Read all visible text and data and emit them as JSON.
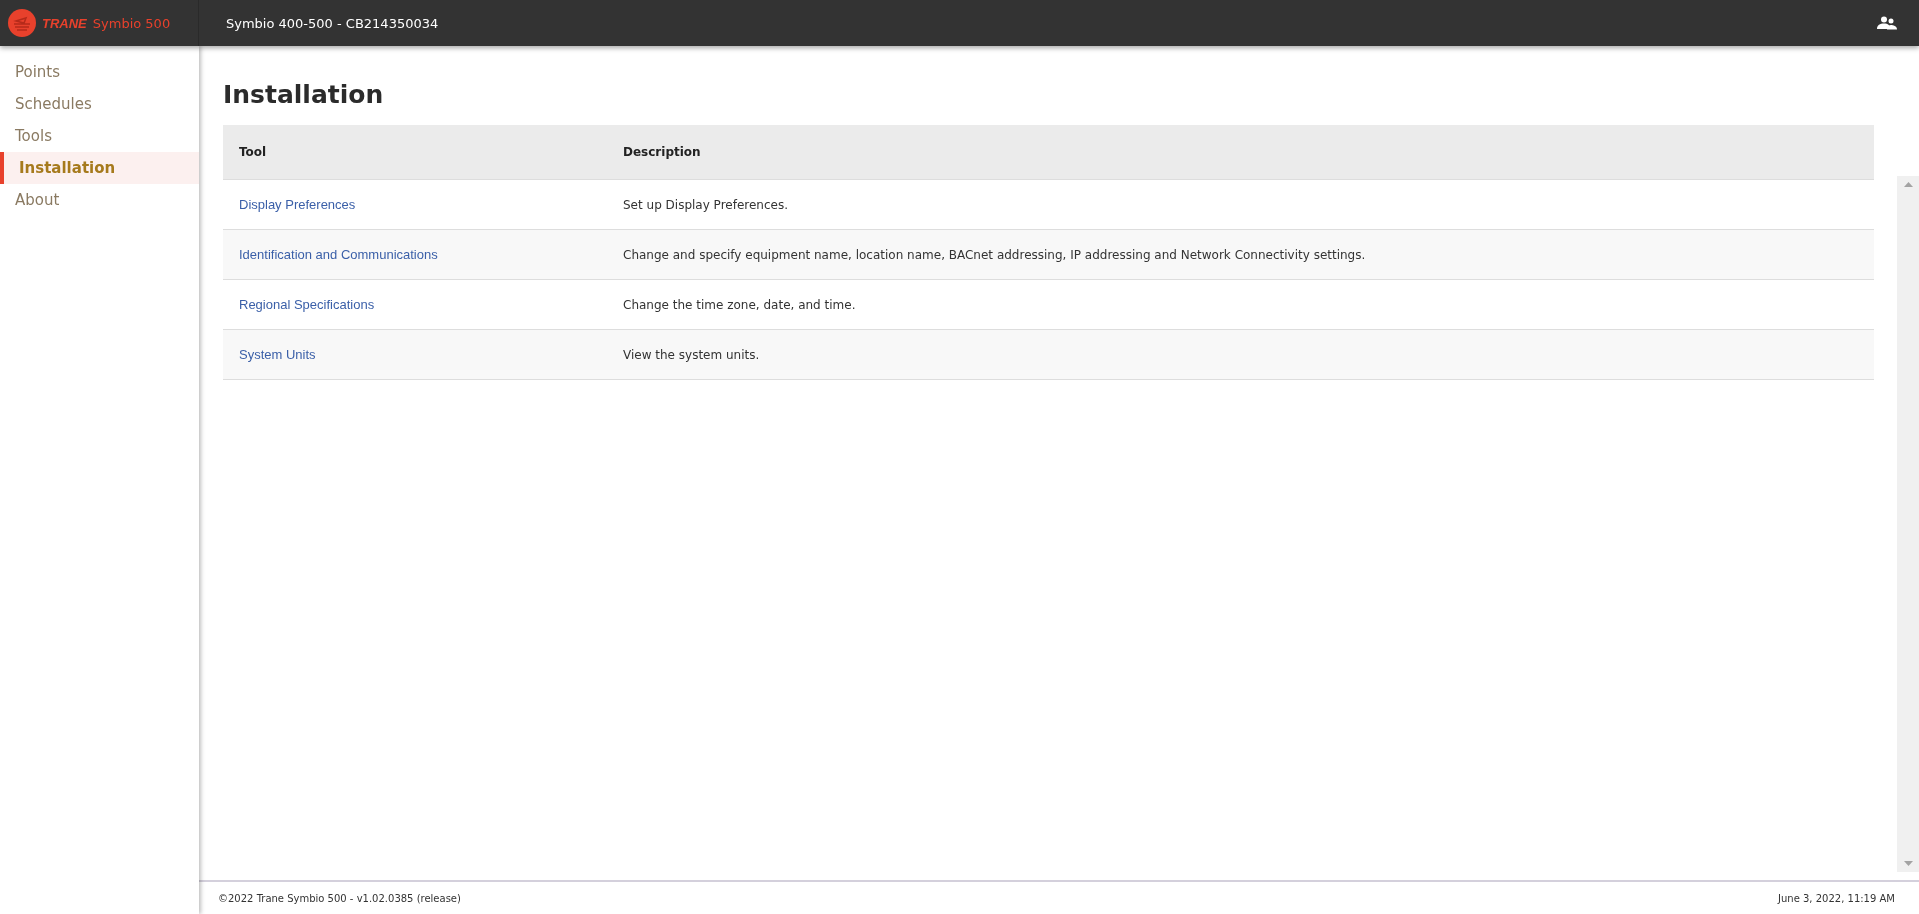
{
  "header": {
    "brand": "TRANE",
    "product": "Symbio 500",
    "device_title": "Symbio 400-500 - CB214350034"
  },
  "sidebar": {
    "items": [
      {
        "label": "Points",
        "selected": false
      },
      {
        "label": "Schedules",
        "selected": false
      },
      {
        "label": "Tools",
        "selected": false
      },
      {
        "label": "Installation",
        "selected": true
      },
      {
        "label": "About",
        "selected": false
      }
    ]
  },
  "page_title": "Installation",
  "table": {
    "columns": [
      "Tool",
      "Description"
    ],
    "rows": [
      {
        "tool": "Display Preferences",
        "description": "Set up Display Preferences."
      },
      {
        "tool": "Identification and Communications",
        "description": "Change and specify equipment name, location name, BACnet addressing, IP addressing and Network Connectivity settings."
      },
      {
        "tool": "Regional Specifications",
        "description": "Change the time zone, date, and time."
      },
      {
        "tool": "System Units",
        "description": "View the system units."
      }
    ]
  },
  "status_bar": {
    "copyright": "©2022 Trane Symbio 500 - v1.02.0385 (release)",
    "datetime": "June 3, 2022, 11:19 AM"
  }
}
